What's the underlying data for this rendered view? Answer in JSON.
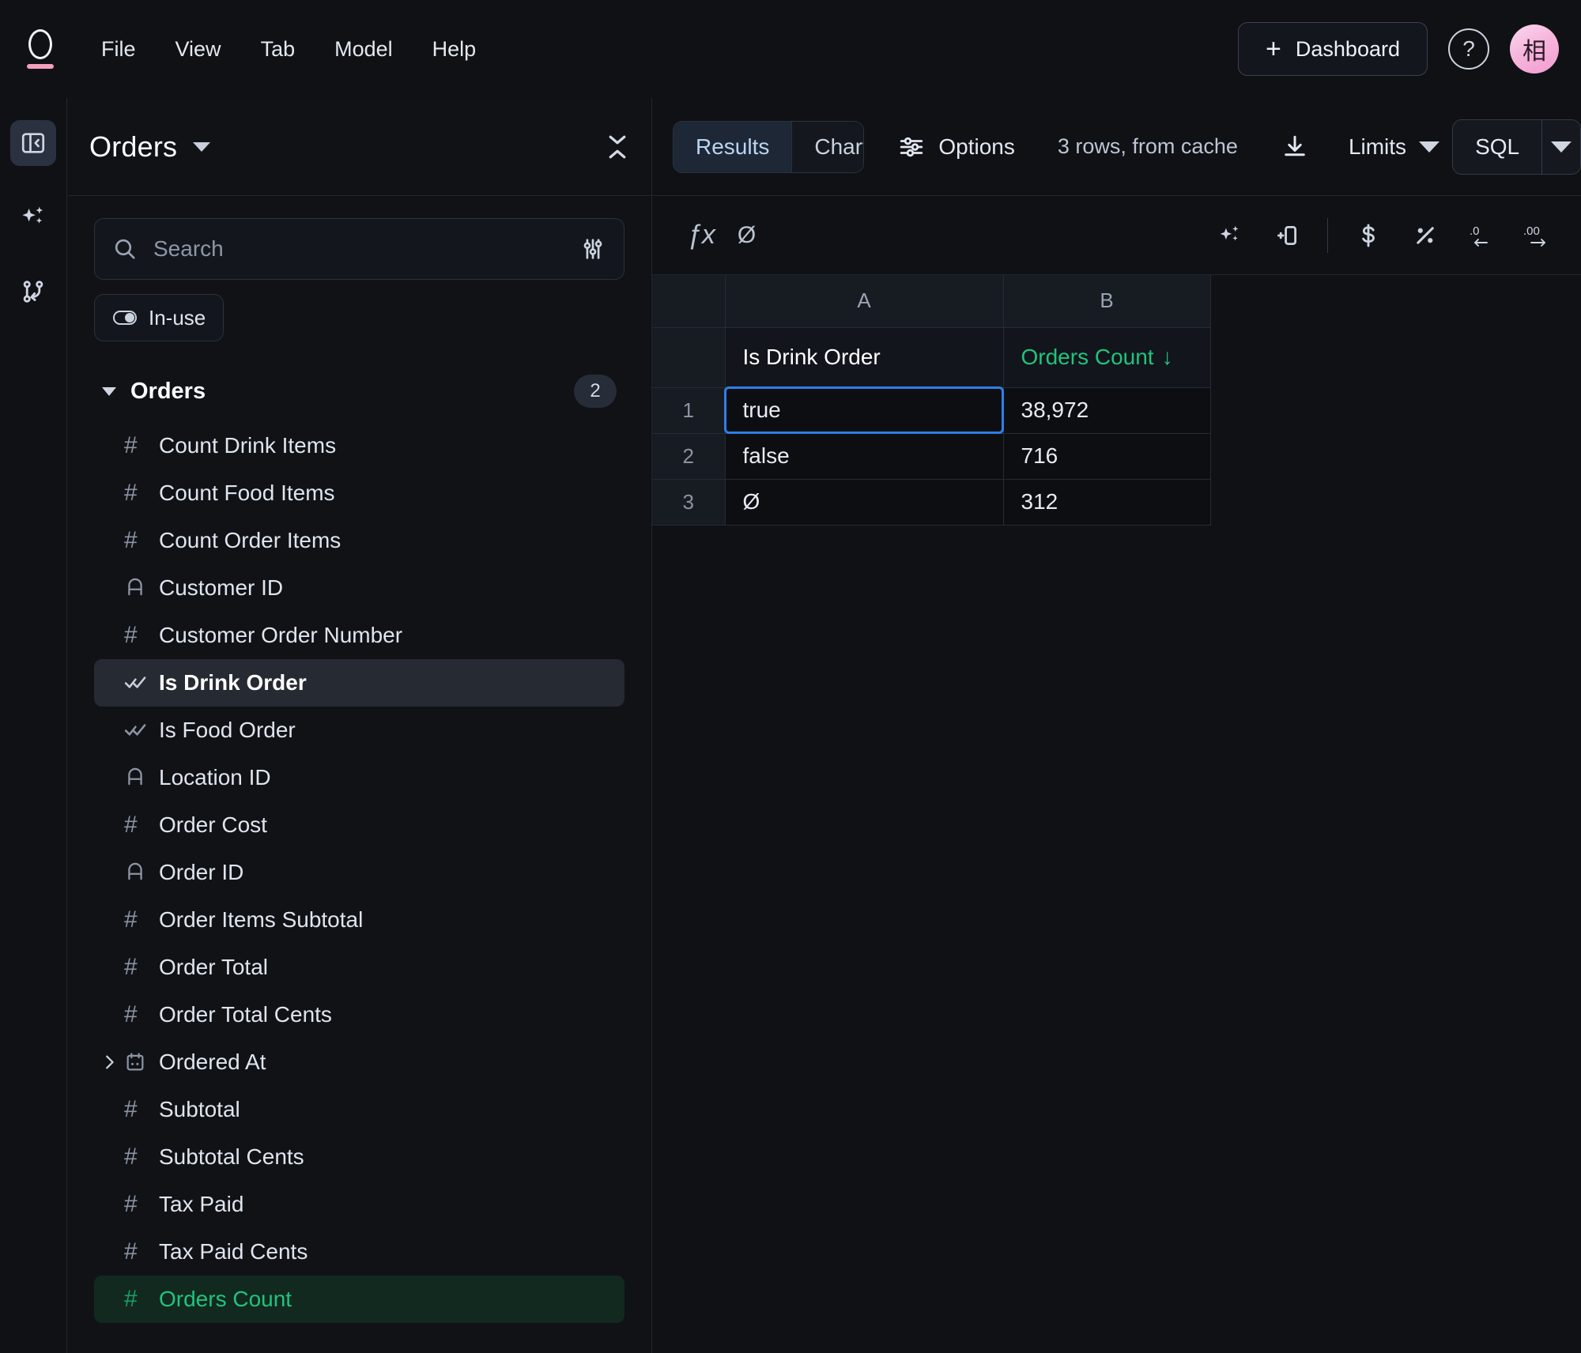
{
  "topbar": {
    "logo": "omni-logo",
    "menu": [
      "File",
      "View",
      "Tab",
      "Model",
      "Help"
    ],
    "dashboard_button": "Dashboard",
    "help_label": "?",
    "avatar_initial": "相"
  },
  "rail": {
    "items": [
      {
        "name": "panel-toggle",
        "label": "Toggle sidebar"
      },
      {
        "name": "ai-assistant",
        "label": "AI"
      },
      {
        "name": "branches",
        "label": "Branches"
      }
    ]
  },
  "sidebar": {
    "title": "Orders",
    "search": {
      "placeholder": "Search",
      "value": ""
    },
    "in_use_chip": "In-use",
    "group": {
      "name": "Orders",
      "count": "2"
    },
    "fields": [
      {
        "label": "Count Drink Items",
        "icon": "number-icon",
        "state": "normal",
        "expandable": false
      },
      {
        "label": "Count Food Items",
        "icon": "number-icon",
        "state": "normal",
        "expandable": false
      },
      {
        "label": "Count Order Items",
        "icon": "number-icon",
        "state": "normal",
        "expandable": false
      },
      {
        "label": "Customer ID",
        "icon": "text-icon",
        "state": "normal",
        "expandable": false
      },
      {
        "label": "Customer Order Number",
        "icon": "number-icon",
        "state": "normal",
        "expandable": false
      },
      {
        "label": "Is Drink Order",
        "icon": "boolean-icon",
        "state": "selected",
        "expandable": false
      },
      {
        "label": "Is Food Order",
        "icon": "boolean-icon",
        "state": "normal",
        "expandable": false
      },
      {
        "label": "Location ID",
        "icon": "text-icon",
        "state": "normal",
        "expandable": false
      },
      {
        "label": "Order Cost",
        "icon": "number-icon",
        "state": "normal",
        "expandable": false
      },
      {
        "label": "Order ID",
        "icon": "text-icon",
        "state": "normal",
        "expandable": false
      },
      {
        "label": "Order Items Subtotal",
        "icon": "number-icon",
        "state": "normal",
        "expandable": false
      },
      {
        "label": "Order Total",
        "icon": "number-icon",
        "state": "normal",
        "expandable": false
      },
      {
        "label": "Order Total Cents",
        "icon": "number-icon",
        "state": "normal",
        "expandable": false
      },
      {
        "label": "Ordered At",
        "icon": "calendar-icon",
        "state": "normal",
        "expandable": true
      },
      {
        "label": "Subtotal",
        "icon": "number-icon",
        "state": "normal",
        "expandable": false
      },
      {
        "label": "Subtotal Cents",
        "icon": "number-icon",
        "state": "normal",
        "expandable": false
      },
      {
        "label": "Tax Paid",
        "icon": "number-icon",
        "state": "normal",
        "expandable": false
      },
      {
        "label": "Tax Paid Cents",
        "icon": "number-icon",
        "state": "normal",
        "expandable": false
      },
      {
        "label": "Orders Count",
        "icon": "number-icon",
        "state": "measure",
        "expandable": false
      }
    ]
  },
  "main": {
    "tabs": [
      {
        "label": "Results",
        "active": true
      },
      {
        "label": "Chart",
        "active": false
      }
    ],
    "options_label": "Options",
    "row_status": "3 rows, from cache",
    "limits_label": "Limits",
    "sql_label": "SQL",
    "format_icons": [
      "ai-format-icon",
      "auto-width-icon",
      "currency-icon",
      "percent-icon",
      "decrease-decimal-icon",
      "increase-decimal-icon"
    ]
  },
  "grid": {
    "column_letters": [
      "A",
      "B"
    ],
    "headers": [
      {
        "label": "Is Drink Order",
        "accent": false,
        "sort": ""
      },
      {
        "label": "Orders Count",
        "accent": true,
        "sort": "↓"
      }
    ],
    "rows": [
      {
        "index": "1",
        "a": "true",
        "b": "38,972"
      },
      {
        "index": "2",
        "a": "false",
        "b": "716"
      },
      {
        "index": "3",
        "a": "Ø",
        "b": "312"
      }
    ]
  },
  "colors": {
    "accent_green": "#1fc47e",
    "selection_blue": "#2f7fe8",
    "brand_pink": "#f4a0ba"
  }
}
